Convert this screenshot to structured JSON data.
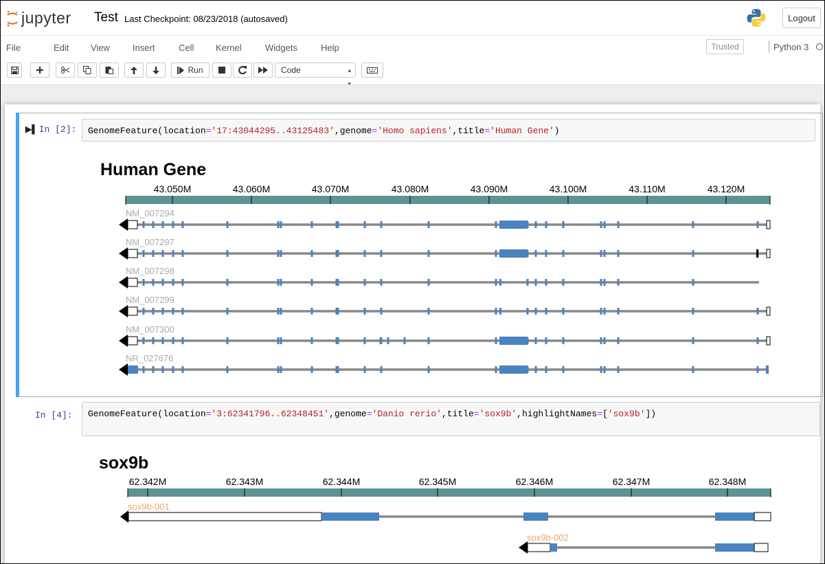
{
  "header": {
    "logo_text": "jupyter",
    "notebook_title": "Test",
    "checkpoint": "Last Checkpoint: 08/23/2018  (autosaved)",
    "logout_label": "Logout"
  },
  "menubar": {
    "items": [
      "File",
      "Edit",
      "View",
      "Insert",
      "Cell",
      "Kernel",
      "Widgets",
      "Help"
    ],
    "trusted_label": "Trusted",
    "kernel_name": "Python 3"
  },
  "toolbar": {
    "run_label": "Run",
    "cell_type": "Code"
  },
  "cells": [
    {
      "prompt": "In [2]:",
      "code": "GenomeFeature(location='17:43044295..43125483',genome='Homo sapiens',title='Human Gene')",
      "code_parts": [
        {
          "t": "GenomeFeature(location",
          "c": ""
        },
        {
          "t": "=",
          "c": "op"
        },
        {
          "t": "'17:43044295..43125483'",
          "c": "str"
        },
        {
          "t": ",genome",
          "c": ""
        },
        {
          "t": "=",
          "c": "op"
        },
        {
          "t": "'Homo sapiens'",
          "c": "str"
        },
        {
          "t": ",title",
          "c": ""
        },
        {
          "t": "=",
          "c": "op"
        },
        {
          "t": "'Human Gene'",
          "c": "str"
        },
        {
          "t": ")",
          "c": ""
        }
      ],
      "output": {
        "title": "Human Gene",
        "axis_ticks": [
          "43.050M",
          "43.060M",
          "43.070M",
          "43.080M",
          "43.090M",
          "43.100M",
          "43.110M",
          "43.120M"
        ],
        "tracks": [
          {
            "name": "NM_007294",
            "color": "#aaaaaa",
            "exon_cols": [
              0,
              1,
              2,
              3,
              4,
              5,
              6,
              7,
              8,
              9,
              10,
              11,
              12,
              13,
              14,
              15,
              16,
              17,
              18,
              19,
              20,
              21,
              22,
              23
            ],
            "big_exon": true,
            "end": "box"
          },
          {
            "name": "NM_007297",
            "color": "#aaaaaa",
            "exon_cols": [
              0,
              1,
              2,
              3,
              4,
              5,
              6,
              7,
              8,
              9,
              10,
              11,
              12,
              13,
              14,
              15,
              16,
              17,
              18,
              19,
              20,
              21,
              22,
              23
            ],
            "big_exon": true,
            "end": "black"
          },
          {
            "name": "NM_007298",
            "color": "#aaaaaa",
            "exon_cols": [
              0,
              1,
              2,
              3,
              4,
              5,
              6,
              7,
              8,
              9,
              10,
              11,
              12,
              13,
              14,
              15,
              16,
              17,
              18,
              19,
              20,
              21,
              22
            ],
            "big_exon": false,
            "end": "none"
          },
          {
            "name": "NM_007299",
            "color": "#aaaaaa",
            "exon_cols": [
              0,
              1,
              2,
              3,
              4,
              5,
              6,
              7,
              8,
              9,
              10,
              11,
              12,
              13,
              14,
              15,
              16,
              17,
              18,
              19,
              20,
              21,
              22,
              23
            ],
            "big_exon": false,
            "end": "box"
          },
          {
            "name": "NM_007300",
            "color": "#aaaaaa",
            "exon_cols": [
              0,
              1,
              2,
              3,
              4,
              5,
              6,
              7,
              8,
              9,
              10,
              11,
              12,
              13,
              14,
              15,
              16,
              17,
              18,
              19,
              20,
              21,
              22,
              23,
              24
            ],
            "big_exon": true,
            "end": "box"
          },
          {
            "name": "NR_027676",
            "color": "#aaaaaa",
            "exon_cols": [
              0,
              1,
              2,
              3,
              4,
              5,
              6,
              7,
              8,
              9,
              10,
              11,
              12,
              13,
              14,
              15,
              16,
              17,
              18,
              19,
              20,
              21,
              22,
              23
            ],
            "big_exon": true,
            "end": "exon"
          }
        ]
      }
    },
    {
      "prompt": "In [4]:",
      "code": "GenomeFeature(location='3:62341796..62348451',genome='Danio rerio',title='sox9b',highlightNames=['sox9b'])",
      "code_parts": [
        {
          "t": "GenomeFeature(location",
          "c": ""
        },
        {
          "t": "=",
          "c": "op"
        },
        {
          "t": "'3:62341796..62348451'",
          "c": "str"
        },
        {
          "t": ",genome",
          "c": ""
        },
        {
          "t": "=",
          "c": "op"
        },
        {
          "t": "'Danio rerio'",
          "c": "str"
        },
        {
          "t": ",title",
          "c": ""
        },
        {
          "t": "=",
          "c": "op"
        },
        {
          "t": "'sox9b'",
          "c": "str"
        },
        {
          "t": ",highlightNames",
          "c": ""
        },
        {
          "t": "=",
          "c": "op"
        },
        {
          "t": "[",
          "c": ""
        },
        {
          "t": "'sox9b'",
          "c": "str"
        },
        {
          "t": "])",
          "c": ""
        }
      ],
      "output": {
        "title": "sox9b",
        "axis_ticks": [
          "62.342M",
          "62.343M",
          "62.344M",
          "62.345M",
          "62.346M",
          "62.347M",
          "62.348M"
        ],
        "tracks": [
          {
            "name": "sox9b-001",
            "color": "#e8a66a"
          },
          {
            "name": "sox9b-002",
            "color": "#e8a66a"
          }
        ]
      }
    }
  ],
  "colors": {
    "axis_bar": "#5f9391",
    "exon": "#4b82c0",
    "intron": "#888888",
    "selected_cell": "#42a5f5",
    "prompt": "#303f9f",
    "string": "#ba2121",
    "operator": "#aa22ff"
  }
}
